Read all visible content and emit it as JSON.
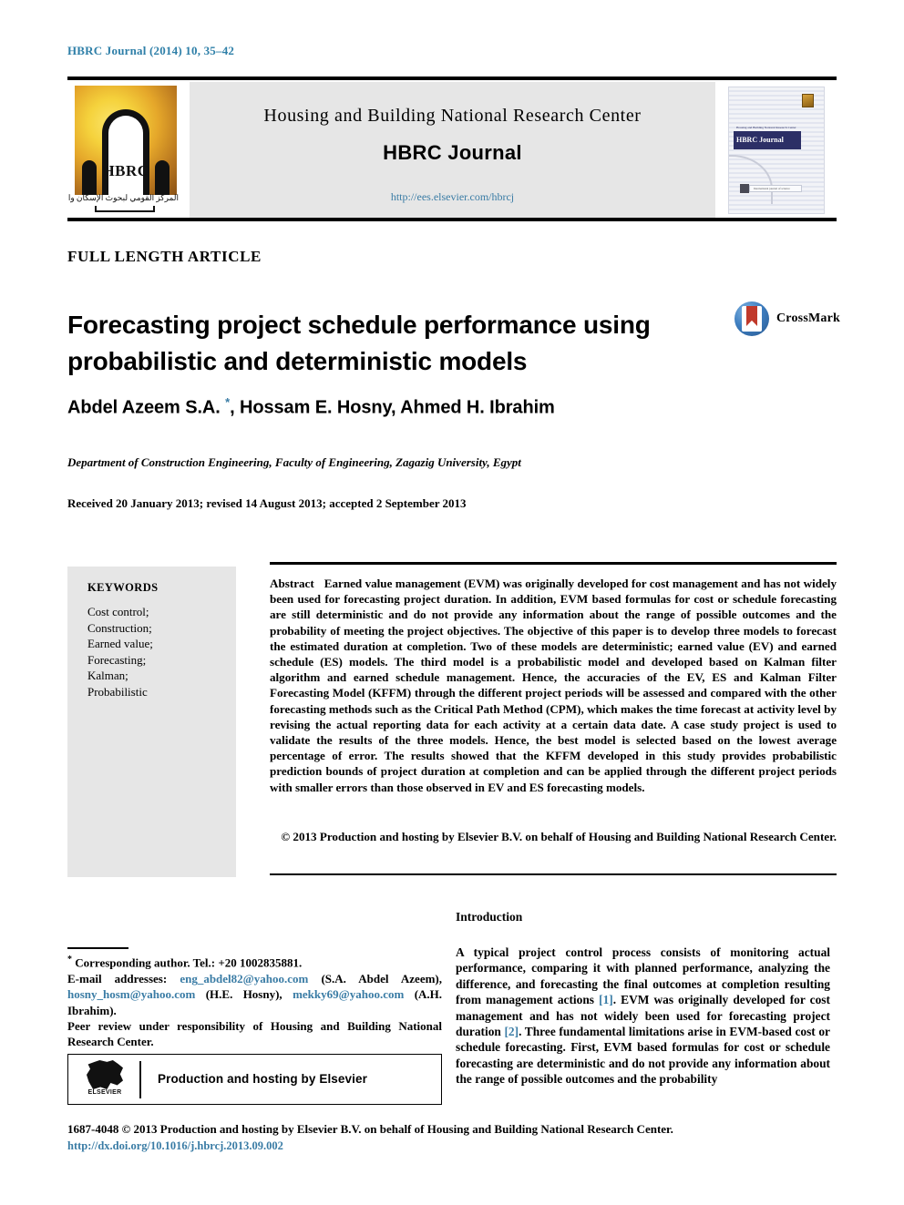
{
  "running_head": "HBRC Journal (2014) 10, 35–42",
  "masthead": {
    "logo": {
      "acronym": "HBRC",
      "arabic": "المركز القومي لبحوث الإسكان والبناء"
    },
    "organization": "Housing and Building National Research Center",
    "journal_title": "HBRC Journal",
    "url": "http://ees.elsevier.com/hbrcj",
    "cover": {
      "band_title": "HBRC Journal",
      "band_subtitle": "Housing and Building National Research Center",
      "footer_text": "International journal of science"
    }
  },
  "article": {
    "type": "FULL LENGTH ARTICLE",
    "title": "Forecasting project schedule performance using probabilistic and deterministic models",
    "crossmark_label": "CrossMark",
    "authors": "Abdel Azeem S.A. ",
    "authors_rest": ", Hossam E. Hosny, Ahmed H. Ibrahim",
    "corresponding_marker": "*",
    "affiliation": "Department of Construction Engineering, Faculty of Engineering, Zagazig University, Egypt",
    "history": "Received 20 January 2013; revised 14 August 2013; accepted 2 September 2013"
  },
  "keywords": {
    "heading": "KEYWORDS",
    "items": "Cost control;\nConstruction;\nEarned value;\nForecasting;\nKalman;\nProbabilistic"
  },
  "abstract": {
    "heading": "Abstract",
    "body": "Earned value management (EVM) was originally developed for cost management and has not widely been used for forecasting project duration. In addition, EVM based formulas for cost or schedule forecasting are still deterministic and do not provide any information about the range of possible outcomes and the probability of meeting the project objectives. The objective of this paper is to develop three models to forecast the estimated duration at completion. Two of these models are deterministic; earned value (EV) and earned schedule (ES) models. The third model is a probabilistic model and developed based on Kalman filter algorithm and earned schedule management. Hence, the accuracies of the EV, ES and Kalman Filter Forecasting Model (KFFM) through the different project periods will be assessed and compared with the other forecasting methods such as the Critical Path Method (CPM), which makes the time forecast at activity level by revising the actual reporting data for each activity at a certain data date. A case study project is used to validate the results of the three models. Hence, the best model is selected based on the lowest average percentage of error. The results showed that the KFFM developed in this study provides probabilistic prediction bounds of project duration at completion and can be applied through the different project periods with smaller errors than those observed in EV and ES forecasting models.",
    "copyright": "© 2013 Production and hosting by Elsevier B.V. on behalf of Housing and Building National Research Center."
  },
  "introduction": {
    "heading": "Introduction",
    "part1": "A typical project control process consists of monitoring actual performance, comparing it with planned performance, analyzing the difference, and forecasting the final outcomes at completion resulting from management actions ",
    "ref1": "[1]",
    "part2": ". EVM was originally developed for cost management and has not widely been used for forecasting project duration ",
    "ref2": "[2]",
    "part3": ". Three fundamental limitations arise in EVM-based cost or schedule forecasting. First, EVM based formulas for cost or schedule forecasting are deterministic and do not provide any information about the range of possible outcomes and the probability"
  },
  "footnotes": {
    "corresponding": "Corresponding author. Tel.: +20 1002835881.",
    "email_label": "E-mail addresses:",
    "email1": "eng_abdel82@yahoo.com",
    "email1_name": "(S.A. Abdel Azeem),",
    "email2": "hosny_hosm@yahoo.com",
    "email2_name": "(H.E. Hosny),",
    "email3": "mekky69@yahoo.com",
    "email3_name": "(A.H. Ibrahim).",
    "peer_review": "Peer review under responsibility of Housing and Building National Research Center.",
    "elsevier_logo_word": "ELSEVIER",
    "elsevier_text": "Production and hosting by Elsevier"
  },
  "bottom": {
    "issn_line": "1687-4048 © 2013 Production and hosting by Elsevier B.V. on behalf of Housing and Building National Research Center.",
    "doi": "http://dx.doi.org/10.1016/j.hbrcj.2013.09.002"
  },
  "colors": {
    "link": "#3a7ca5",
    "panel_gray": "#e6e6e6",
    "cover_navy": "#2c2f66",
    "crossmark_red": "#c0392b"
  }
}
